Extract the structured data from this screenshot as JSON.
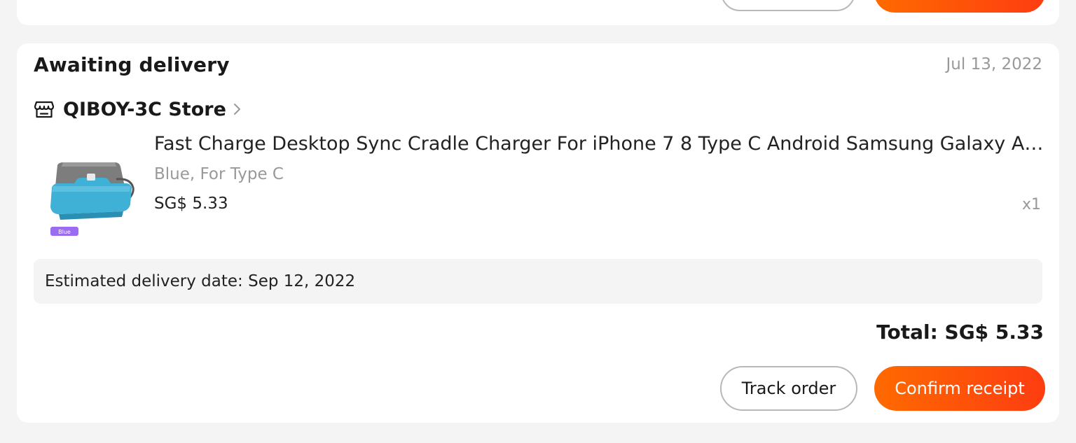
{
  "colors": {
    "accent_start": "#ff6a00",
    "accent_end": "#fd3d11",
    "muted_text": "#999999",
    "background": "#f4f4f4"
  },
  "order": {
    "status": "Awaiting delivery",
    "date": "Jul 13, 2022",
    "store": {
      "name": "QIBOY-3C Store",
      "icon": "store-icon"
    },
    "item": {
      "title": "Fast Charge Desktop Sync Cradle Charger For iPhone 7 8 Type C Android Samsung Galaxy A50 U...",
      "variant": "Blue, For Type C",
      "price": "SG$ 5.33",
      "quantity": "x1",
      "thumb_tag": "Blue"
    },
    "estimated_delivery": "Estimated delivery date: Sep 12, 2022",
    "total": "Total: SG$ 5.33",
    "actions": {
      "track_label": "Track order",
      "confirm_label": "Confirm receipt"
    }
  }
}
